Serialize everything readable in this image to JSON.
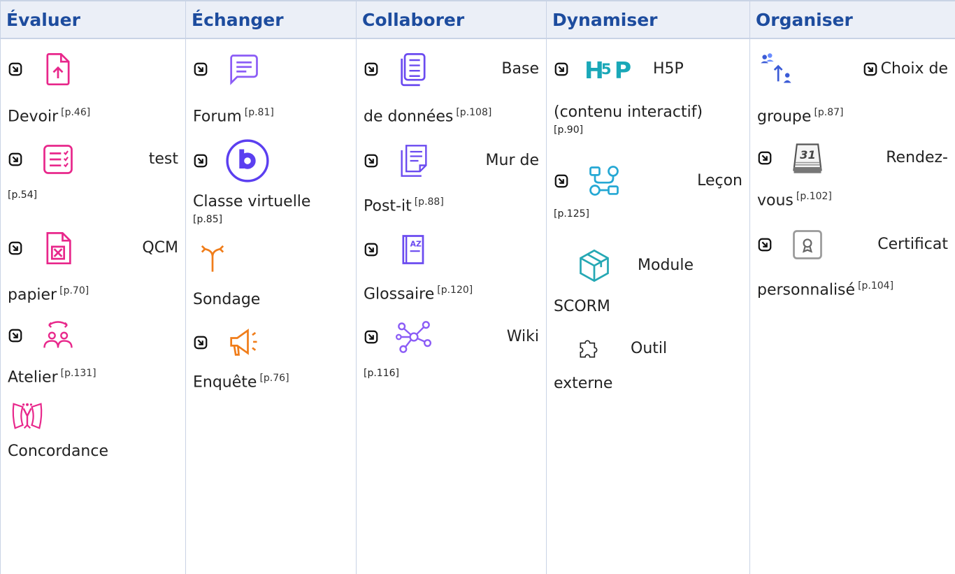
{
  "headers": [
    "Évaluer",
    "Échanger",
    "Collaborer",
    "Dynamiser",
    "Organiser"
  ],
  "colors": {
    "header_bg": "#ebeff7",
    "header_text": "#1d4c9e",
    "pink": "#e8278b",
    "purple": "#6b4bf0",
    "orange": "#f07d1a",
    "teal": "#25a8b4"
  },
  "evaluer": {
    "devoir": {
      "name": "Devoir",
      "ref": "[p.46]",
      "icon": "assignment-upload-icon"
    },
    "test": {
      "name": "test",
      "ref": "[p.54]",
      "icon": "quiz-icon"
    },
    "qcm": {
      "name1": "QCM",
      "name2": "papier",
      "ref": "[p.70]",
      "icon": "paper-quiz-icon"
    },
    "atelier": {
      "name": "Atelier",
      "ref": "[p.131]",
      "icon": "workshop-icon"
    },
    "concordance": {
      "name": "Concordance",
      "icon": "concordance-icon"
    }
  },
  "echanger": {
    "forum": {
      "name": "Forum",
      "ref": "[p.81]",
      "icon": "forum-icon"
    },
    "classe": {
      "name": "Classe virtuelle",
      "ref": "[p.85]",
      "icon": "bigbluebutton-icon"
    },
    "sondage": {
      "name": "Sondage",
      "icon": "choice-icon"
    },
    "enquete": {
      "name": "Enquête",
      "ref": "[p.76]",
      "icon": "feedback-icon"
    }
  },
  "collaborer": {
    "base": {
      "name1": "Base",
      "name2": "de données",
      "ref": "[p.108]",
      "icon": "database-icon"
    },
    "mur": {
      "name1": "Mur de",
      "name2": "Post-it",
      "ref": "[p.88]",
      "icon": "postit-wall-icon"
    },
    "glossaire": {
      "name": "Glossaire",
      "ref": "[p.120]",
      "icon": "glossary-icon"
    },
    "wiki": {
      "name": "Wiki",
      "ref": "[p.116]",
      "icon": "wiki-icon"
    }
  },
  "dynamiser": {
    "h5p": {
      "name1": "H5P",
      "name2": "(contenu interactif)",
      "ref": "[p.90]",
      "icon": "h5p-icon"
    },
    "lecon": {
      "name": "Leçon",
      "ref": "[p.125]",
      "icon": "lesson-icon"
    },
    "scorm": {
      "name1": "Module",
      "name2": "SCORM",
      "icon": "scorm-package-icon"
    },
    "outil": {
      "name1": "Outil",
      "name2": "externe",
      "icon": "external-tool-icon"
    }
  },
  "organiser": {
    "groupe": {
      "name1": "Choix de",
      "name2": "groupe",
      "ref": "[p.87]",
      "icon": "group-choice-icon"
    },
    "rdv": {
      "name1": "Rendez-",
      "name2": "vous",
      "ref": "[p.102]",
      "icon": "calendar-icon",
      "calendar_day": "31"
    },
    "certif": {
      "name1": "Certificat",
      "name2": "personnalisé",
      "ref": "[p.104]",
      "icon": "certificate-icon"
    }
  }
}
